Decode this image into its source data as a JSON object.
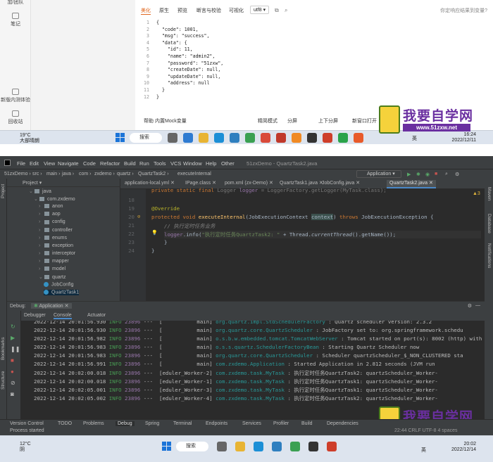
{
  "top": {
    "sidebar": {
      "items": [
        {
          "label": "加/团队"
        },
        {
          "label": "笔记"
        },
        {
          "label": "新版内测体验"
        },
        {
          "label": "回收站"
        }
      ]
    },
    "resp_tabs": [
      "美化",
      "原生",
      "预览",
      "断言与校验",
      "可视化"
    ],
    "encoding": "utf8",
    "resp_hint": "你定响应结果到变量?",
    "json_lines": [
      {
        "n": "1",
        "t": "{"
      },
      {
        "n": "2",
        "t": "  \"code\": 1001,"
      },
      {
        "n": "3",
        "t": "  \"msg\": \"success\","
      },
      {
        "n": "4",
        "t": "  \"data\": {"
      },
      {
        "n": "5",
        "t": "    \"id\": 11,"
      },
      {
        "n": "6",
        "t": "    \"name\": \"admin2\","
      },
      {
        "n": "7",
        "t": "    \"password\": \"51zxw\","
      },
      {
        "n": "8",
        "t": "    \"createDate\": null,"
      },
      {
        "n": "9",
        "t": "    \"updateDate\": null,"
      },
      {
        "n": "10",
        "t": "    \"address\": null"
      },
      {
        "n": "11",
        "t": "  }"
      },
      {
        "n": "12",
        "t": "}"
      }
    ],
    "footer": [
      "帮助",
      "内置Mock变量",
      "精简模式",
      "分屏",
      "上下分屏",
      "新窗口打开"
    ],
    "taskbar": {
      "weather_temp": "19°C",
      "weather_desc": "大部晴朗",
      "search": "搜索",
      "ime": "英",
      "time": "16:24",
      "date": "2022/12/11"
    }
  },
  "watermark": {
    "cn": "我要自学网",
    "url": "www.51zxw.net"
  },
  "ide": {
    "menu": [
      "File",
      "Edit",
      "View",
      "Navigate",
      "Code",
      "Refactor",
      "Build",
      "Run",
      "Tools",
      "VCS",
      "Window",
      "Help",
      "Other"
    ],
    "window_title": "51zxDemo - QuartzTask2.java",
    "breadcrumb": [
      "51zxDemo",
      "src",
      "main",
      "java",
      "com",
      "zxdemo",
      "quartz",
      "QuartzTask2",
      "executeInternal"
    ],
    "run_config": "Application",
    "project_label": "Project",
    "tree": [
      {
        "label": "java",
        "d": 3,
        "type": "folder"
      },
      {
        "label": "com.zxdemo",
        "d": 4,
        "type": "folder"
      },
      {
        "label": "anon",
        "d": 5,
        "type": "folder"
      },
      {
        "label": "aop",
        "d": 5,
        "type": "folder"
      },
      {
        "label": "config",
        "d": 5,
        "type": "folder"
      },
      {
        "label": "controller",
        "d": 5,
        "type": "folder"
      },
      {
        "label": "enums",
        "d": 5,
        "type": "folder"
      },
      {
        "label": "exception",
        "d": 5,
        "type": "folder"
      },
      {
        "label": "interceptor",
        "d": 5,
        "type": "folder"
      },
      {
        "label": "mapper",
        "d": 5,
        "type": "folder"
      },
      {
        "label": "model",
        "d": 5,
        "type": "folder"
      },
      {
        "label": "quartz",
        "d": 5,
        "type": "folder"
      },
      {
        "label": "JobConfig",
        "d": 6,
        "type": "class"
      },
      {
        "label": "QuartzTask1",
        "d": 6,
        "type": "class"
      }
    ],
    "tabs": [
      "application-local.yml",
      "IPage.class",
      "pom.xml (zx-Demo)",
      "QuartzTask1.java",
      "JobConfig.java",
      "QuartzTask2.java"
    ],
    "warnings": "▲3",
    "code_lines": [
      "18",
      "19",
      "20",
      "21",
      "22",
      "23",
      "24"
    ],
    "code": {
      "override": "@Override",
      "kw1": "protected void ",
      "method": "executeInternal",
      "params_a": "(JobExecutionContext ",
      "params_b": "context",
      "params_c": ") ",
      "throws": "throws ",
      "exc": "JobExecutionException {",
      "comment": "// 执行定时任务业务",
      "log_a": "logger",
      "log_b": ".info(",
      "log_str": "\"执行定时任务QuartzTask2: \" ",
      "log_c": "+ Thread.",
      "log_d": "currentThread",
      "log_e": "().getName());",
      "close1": "}",
      "close2": "}"
    },
    "debug_label": "Debug:",
    "debug_app": "Application",
    "debug_tabs": [
      "Debugger",
      "Console",
      "Actuator"
    ],
    "console": [
      {
        "ts": "2022-12-14 20:01:56.930",
        "lvl": "INFO",
        "pid": "23896",
        "th": "---  [           main]",
        "lg": "org.quartz.impl.StdSchedulerFactory",
        "msg": ": Quartz scheduler version: 2.3.2"
      },
      {
        "ts": "2022-12-14 20:01:56.930",
        "lvl": "INFO",
        "pid": "23896",
        "th": "---  [           main]",
        "lg": "org.quartz.core.QuartzScheduler",
        "msg": ": JobFactory set to: org.springframework.schedu"
      },
      {
        "ts": "2022-12-14 20:01:56.982",
        "lvl": "INFO",
        "pid": "23896",
        "th": "---  [           main]",
        "lg": "o.s.b.w.embedded.tomcat.TomcatWebServer",
        "msg": ": Tomcat started on port(s): 8002 (http) with c"
      },
      {
        "ts": "2022-12-14 20:01:56.983",
        "lvl": "INFO",
        "pid": "23896",
        "th": "---  [           main]",
        "lg": "o.s.s.quartz.SchedulerFactoryBean",
        "msg": ": Starting Quartz Scheduler now"
      },
      {
        "ts": "2022-12-14 20:01:56.983",
        "lvl": "INFO",
        "pid": "23896",
        "th": "---  [           main]",
        "lg": "org.quartz.core.QuartzScheduler",
        "msg": ": Scheduler quartzScheduler_$_NON_CLUSTERED sta"
      },
      {
        "ts": "2022-12-14 20:01:56.991",
        "lvl": "INFO",
        "pid": "23896",
        "th": "---  [           main]",
        "lg": "com.zxdemo.Application",
        "msg": ": Started Application in 2.812 seconds (JVM run"
      },
      {
        "ts": "2022-12-14 20:02:00.018",
        "lvl": "INFO",
        "pid": "23896",
        "th": "---  [eduler_Worker-2]",
        "lg": "com.zxdemo.task.MyTask",
        "msg": ": 执行定时任务QuartzTask2: quartzScheduler_Worker-"
      },
      {
        "ts": "2022-12-14 20:02:00.018",
        "lvl": "INFO",
        "pid": "23896",
        "th": "---  [eduler_Worker-1]",
        "lg": "com.zxdemo.task.MyTask",
        "msg": ": 执行定时任务QuartzTask1: quartzScheduler_Worker-"
      },
      {
        "ts": "2022-12-14 20:02:05.001",
        "lvl": "INFO",
        "pid": "23896",
        "th": "---  [eduler_Worker-3]",
        "lg": "com.zxdemo.task.MyTask",
        "msg": ": 执行定时任务QuartzTask1: quartzScheduler_Worker-"
      },
      {
        "ts": "2022-12-14 20:02:05.002",
        "lvl": "INFO",
        "pid": "23896",
        "th": "---  [eduler_Worker-4]",
        "lg": "com.zxdemo.task.MyTask",
        "msg": ": 执行定时任务QuartzTask2: quartzScheduler_Worker-"
      }
    ],
    "bottom_tools": [
      "Version Control",
      "TODO",
      "Problems",
      "Debug",
      "Spring",
      "Terminal",
      "Endpoints",
      "Services",
      "Profiler",
      "Build",
      "Dependencies"
    ],
    "status": "Process started",
    "status_right": "22:44  CRLF  UTF-8  4 spaces",
    "right_tools": [
      "Maven",
      "Database",
      "Notifications"
    ],
    "left_tools": [
      "Project"
    ],
    "left_bottom_tools": [
      "Bookmarks",
      "Structure"
    ]
  },
  "bottom_taskbar": {
    "weather_temp": "12°C",
    "weather_desc": "阴",
    "search": "搜索",
    "ime": "英",
    "time": "20:02",
    "date": "2022/12/14"
  },
  "colors": {
    "accent": "#e0671f",
    "ide_bg": "#2b2b2b",
    "ide_panel": "#3c3f41",
    "watermark": "#6a2fa0"
  }
}
